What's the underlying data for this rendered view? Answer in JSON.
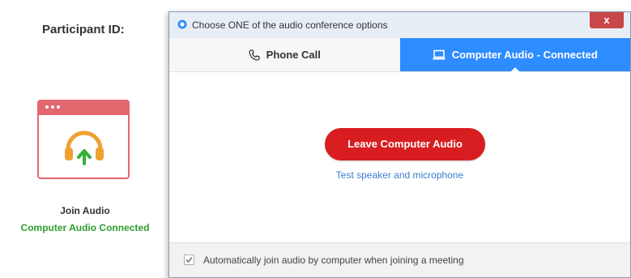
{
  "left_panel": {
    "participant_id_label": "Participant ID:",
    "join_audio_label": "Join Audio",
    "join_audio_status": "Computer Audio Connected"
  },
  "dialog": {
    "title": "Choose ONE of the audio conference options",
    "close_label": "x",
    "tabs": [
      {
        "label": "Phone Call",
        "icon": "phone-icon",
        "active": false
      },
      {
        "label": "Computer Audio - Connected",
        "icon": "computer-icon",
        "active": true
      }
    ],
    "leave_button_label": "Leave Computer Audio",
    "test_link_label": "Test speaker and microphone",
    "auto_join_label": "Automatically join audio by computer when joining a meeting",
    "auto_join_checked": true
  },
  "colors": {
    "accent_blue": "#2d8cff",
    "leave_red": "#d81d20",
    "status_green": "#2e9e2e",
    "tile_red": "#e2676f",
    "headphones_orange": "#f0a030"
  }
}
